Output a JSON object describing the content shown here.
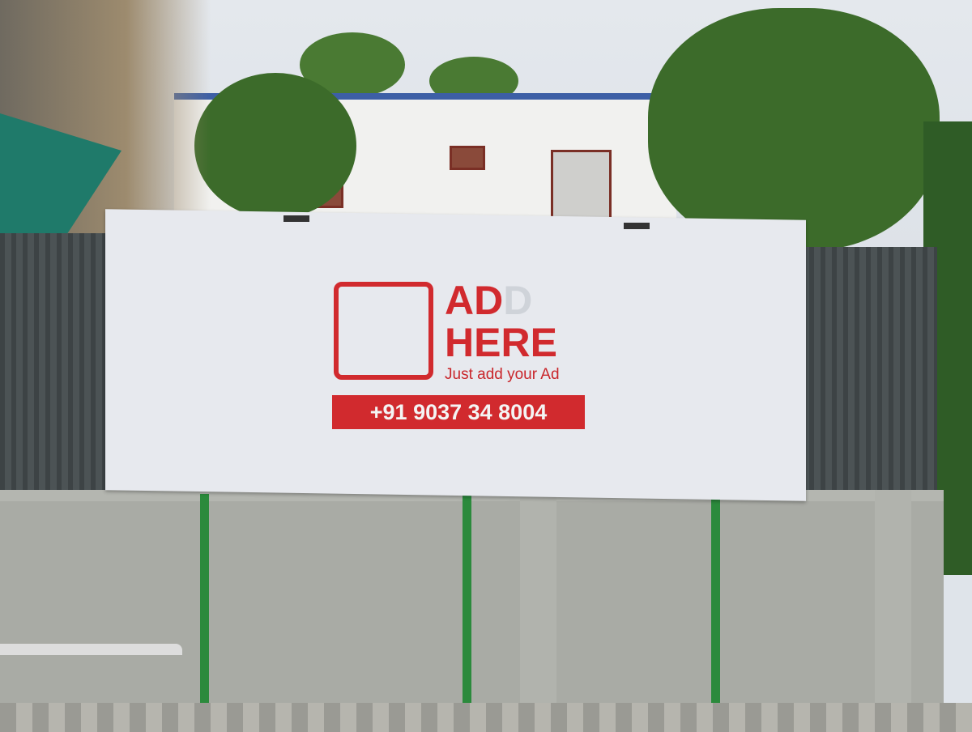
{
  "billboard": {
    "brand_line1": "AD",
    "brand_line1_ghost": "D",
    "brand_line2": "HERE",
    "tagline": "Just add your Ad",
    "phone": "+91 9037 34 8004"
  },
  "colors": {
    "brand_red": "#d12a2e",
    "board": "#e7e9ee"
  }
}
